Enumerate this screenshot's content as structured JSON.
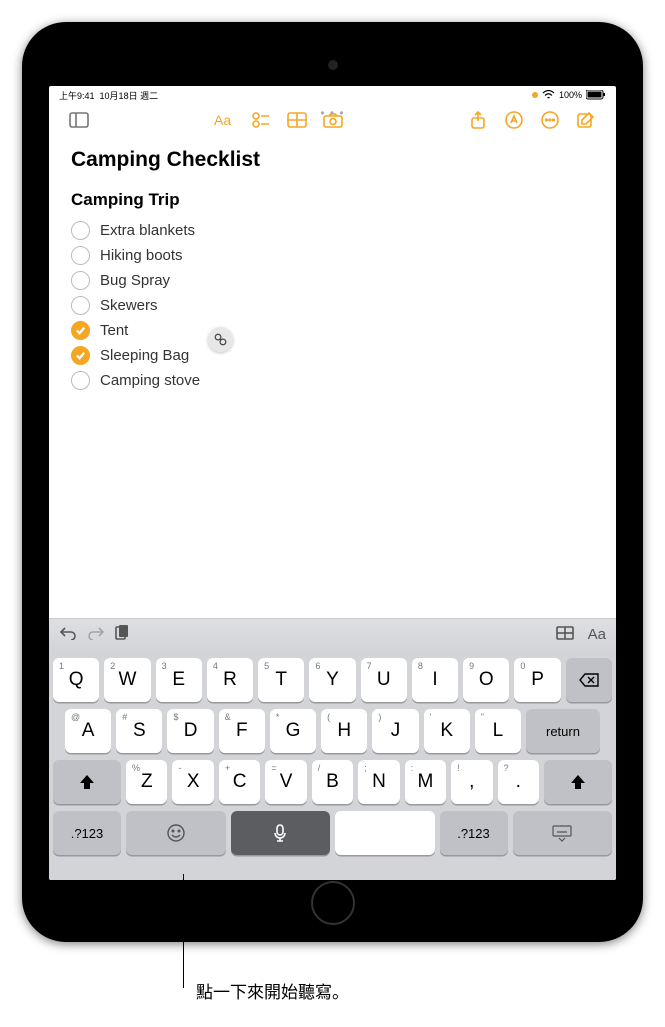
{
  "status": {
    "time": "上午9:41",
    "date": "10月18日 週二",
    "battery": "100%"
  },
  "note": {
    "title": "Camping Checklist",
    "section": "Camping Trip",
    "items": [
      {
        "label": "Extra blankets",
        "checked": false
      },
      {
        "label": "Hiking boots",
        "checked": false
      },
      {
        "label": "Bug Spray",
        "checked": false
      },
      {
        "label": "Skewers",
        "checked": false
      },
      {
        "label": "Tent",
        "checked": true
      },
      {
        "label": "Sleeping Bag",
        "checked": true
      },
      {
        "label": "Camping stove",
        "checked": false
      }
    ]
  },
  "keyboard": {
    "row1": [
      {
        "main": "Q",
        "alt": "1"
      },
      {
        "main": "W",
        "alt": "2"
      },
      {
        "main": "E",
        "alt": "3"
      },
      {
        "main": "R",
        "alt": "4"
      },
      {
        "main": "T",
        "alt": "5"
      },
      {
        "main": "Y",
        "alt": "6"
      },
      {
        "main": "U",
        "alt": "7"
      },
      {
        "main": "I",
        "alt": "8"
      },
      {
        "main": "O",
        "alt": "9"
      },
      {
        "main": "P",
        "alt": "0"
      }
    ],
    "row2": [
      {
        "main": "A",
        "alt": "@"
      },
      {
        "main": "S",
        "alt": "#"
      },
      {
        "main": "D",
        "alt": "$"
      },
      {
        "main": "F",
        "alt": "&"
      },
      {
        "main": "G",
        "alt": "*"
      },
      {
        "main": "H",
        "alt": "("
      },
      {
        "main": "J",
        "alt": ")"
      },
      {
        "main": "K",
        "alt": "'"
      },
      {
        "main": "L",
        "alt": "\""
      }
    ],
    "row3": [
      {
        "main": "Z",
        "alt": "%"
      },
      {
        "main": "X",
        "alt": "-"
      },
      {
        "main": "C",
        "alt": "+"
      },
      {
        "main": "V",
        "alt": "="
      },
      {
        "main": "B",
        "alt": "/"
      },
      {
        "main": "N",
        "alt": ";"
      },
      {
        "main": "M",
        "alt": ":"
      }
    ],
    "return": "return",
    "numkey": ".?123",
    "comma": ",",
    "commaAlt": "!",
    "period": ".",
    "periodAlt": "?"
  },
  "callout": "點一下來開始聽寫。"
}
